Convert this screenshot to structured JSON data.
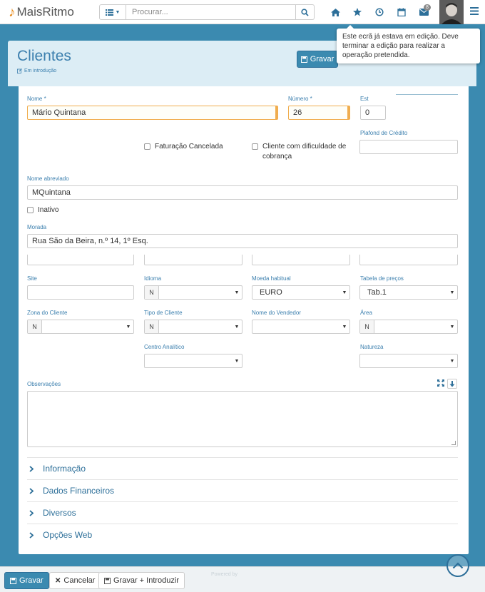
{
  "brand": {
    "name": "MaisRitmo",
    "accent": "#3b8ab0",
    "logo_color": "#e88a1a"
  },
  "navbar": {
    "search_placeholder": "Procurar...",
    "icons": [
      "list-icon",
      "search-icon",
      "home-icon",
      "star-icon",
      "clock-icon",
      "calendar-icon",
      "envelope-icon",
      "avatar",
      "hamburger-icon"
    ],
    "mail_badge": "8"
  },
  "tooltip": {
    "text": "Este ecrã já estava em edição. Deve terminar a edição para realizar a operação pretendida."
  },
  "header": {
    "title": "Clientes",
    "status": "Em introdução",
    "save_label": "Gravar"
  },
  "form": {
    "nome": {
      "label": "Nome *",
      "value": "Mário Quintana"
    },
    "numero": {
      "label": "Número *",
      "value": "26"
    },
    "est": {
      "label": "Est",
      "value": "0"
    },
    "plafond": {
      "label": "Plafond de Crédito",
      "value": ""
    },
    "faturacao_cancelada": {
      "label": "Faturação Cancelada",
      "checked": false
    },
    "dificuldade_cobranca": {
      "label": "Cliente com dificuldade de cobrança",
      "checked": false
    },
    "nome_abreviado": {
      "label": "Nome abreviado",
      "value": "MQuintana"
    },
    "inativo": {
      "label": "Inativo",
      "checked": false
    },
    "morada": {
      "label": "Morada",
      "value": "Rua São da Beira, n.º 14, 1º Esq."
    },
    "site": {
      "label": "Site",
      "value": ""
    },
    "idioma": {
      "label": "Idioma",
      "prefix": "N",
      "value": ""
    },
    "moeda": {
      "label": "Moeda habitual",
      "value": "EURO"
    },
    "tabela_precos": {
      "label": "Tabela de preços",
      "value": "Tab.1"
    },
    "zona": {
      "label": "Zona do Cliente",
      "prefix": "N",
      "value": ""
    },
    "tipo": {
      "label": "Tipo de Cliente",
      "prefix": "N",
      "value": ""
    },
    "vendedor": {
      "label": "Nome do Vendedor",
      "value": ""
    },
    "area": {
      "label": "Área",
      "prefix": "N",
      "value": ""
    },
    "centro_analitico": {
      "label": "Centro Analítico",
      "value": ""
    },
    "natureza": {
      "label": "Natureza",
      "value": ""
    },
    "observacoes": {
      "label": "Observações",
      "value": ""
    }
  },
  "sections": [
    {
      "label": "Informação"
    },
    {
      "label": "Dados Financeiros"
    },
    {
      "label": "Diversos"
    },
    {
      "label": "Opções Web"
    }
  ],
  "footer": {
    "save_label": "Gravar",
    "cancel_label": "Cancelar",
    "save_new_label": "Gravar + Introduzir",
    "powered": "Powered by"
  }
}
